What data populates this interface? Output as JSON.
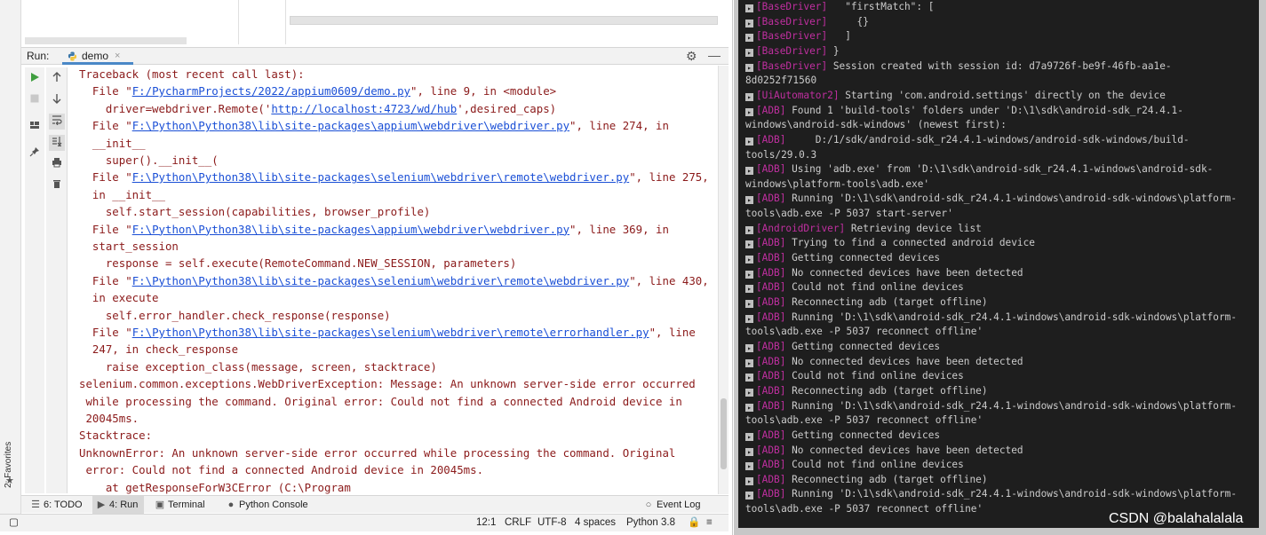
{
  "ide": {
    "run_label": "Run:",
    "run_tab": "demo",
    "run_tab_close": "×",
    "favorites_label": "2: Favorites",
    "console_lines": [
      {
        "segs": [
          {
            "t": "Traceback (most recent call last):"
          }
        ]
      },
      {
        "segs": [
          {
            "t": "  File \""
          },
          {
            "t": "F:/PycharmProjects/2022/appium0609/demo.py",
            "link": true
          },
          {
            "t": "\", line 9, in <module>"
          }
        ]
      },
      {
        "segs": [
          {
            "t": "    driver=webdriver.Remote('"
          },
          {
            "t": "http://localhost:4723/wd/hub",
            "link": true
          },
          {
            "t": "',desired_caps)"
          }
        ]
      },
      {
        "segs": [
          {
            "t": "  File \""
          },
          {
            "t": "F:\\Python\\Python38\\lib\\site-packages\\appium\\webdriver\\webdriver.py",
            "link": true
          },
          {
            "t": "\", line 274, in"
          }
        ]
      },
      {
        "segs": [
          {
            "t": "  __init__"
          }
        ]
      },
      {
        "segs": [
          {
            "t": "    super().__init__("
          }
        ]
      },
      {
        "segs": [
          {
            "t": "  File \""
          },
          {
            "t": "F:\\Python\\Python38\\lib\\site-packages\\selenium\\webdriver\\remote\\webdriver.py",
            "link": true
          },
          {
            "t": "\", line 275,"
          }
        ]
      },
      {
        "segs": [
          {
            "t": "  in __init__"
          }
        ]
      },
      {
        "segs": [
          {
            "t": "    self.start_session(capabilities, browser_profile)"
          }
        ]
      },
      {
        "segs": [
          {
            "t": "  File \""
          },
          {
            "t": "F:\\Python\\Python38\\lib\\site-packages\\appium\\webdriver\\webdriver.py",
            "link": true
          },
          {
            "t": "\", line 369, in"
          }
        ]
      },
      {
        "segs": [
          {
            "t": "  start_session"
          }
        ]
      },
      {
        "segs": [
          {
            "t": "    response = self.execute(RemoteCommand.NEW_SESSION, parameters)"
          }
        ]
      },
      {
        "segs": [
          {
            "t": "  File \""
          },
          {
            "t": "F:\\Python\\Python38\\lib\\site-packages\\selenium\\webdriver\\remote\\webdriver.py",
            "link": true
          },
          {
            "t": "\", line 430,"
          }
        ]
      },
      {
        "segs": [
          {
            "t": "  in execute"
          }
        ]
      },
      {
        "segs": [
          {
            "t": "    self.error_handler.check_response(response)"
          }
        ]
      },
      {
        "segs": [
          {
            "t": "  File \""
          },
          {
            "t": "F:\\Python\\Python38\\lib\\site-packages\\selenium\\webdriver\\remote\\errorhandler.py",
            "link": true
          },
          {
            "t": "\", line"
          }
        ]
      },
      {
        "segs": [
          {
            "t": "  247, in check_response"
          }
        ]
      },
      {
        "segs": [
          {
            "t": "    raise exception_class(message, screen, stacktrace)"
          }
        ]
      },
      {
        "segs": [
          {
            "t": "selenium.common.exceptions.WebDriverException: Message: An unknown server-side error occurred"
          }
        ]
      },
      {
        "segs": [
          {
            "t": " while processing the command. Original error: Could not find a connected Android device in"
          }
        ]
      },
      {
        "segs": [
          {
            "t": " 20045ms."
          }
        ]
      },
      {
        "segs": [
          {
            "t": "Stacktrace:"
          }
        ]
      },
      {
        "segs": [
          {
            "t": "UnknownError: An unknown server-side error occurred while processing the command. Original"
          }
        ]
      },
      {
        "segs": [
          {
            "t": " error: Could not find a connected Android device in 20045ms."
          }
        ]
      },
      {
        "segs": [
          {
            "t": "    at getResponseForW3CError (C:\\Program"
          }
        ]
      }
    ],
    "bottom_tabs": [
      {
        "label": "6: TODO",
        "icon": "list-icon",
        "active": false
      },
      {
        "label": "4: Run",
        "icon": "run-icon",
        "active": true
      },
      {
        "label": "Terminal",
        "icon": "terminal-icon",
        "active": false
      },
      {
        "label": "Python Console",
        "icon": "python-icon",
        "active": false
      }
    ],
    "event_log": "Event Log",
    "status": {
      "position": "12:1",
      "line_sep": "CRLF",
      "encoding": "UTF-8",
      "indent": "4 spaces",
      "interpreter": "Python 3.8"
    },
    "colors": {
      "error_text": "#8b1a1a",
      "link": "#1a4fd6",
      "run_green": "#3f9e3f"
    }
  },
  "terminal": {
    "lines": [
      {
        "tag": "[BaseDriver]",
        "text": "  \"firstMatch\": ["
      },
      {
        "tag": "[BaseDriver]",
        "text": "    {}"
      },
      {
        "tag": "[BaseDriver]",
        "text": "  ]"
      },
      {
        "tag": "[BaseDriver]",
        "text": "}"
      },
      {
        "tag": "[BaseDriver]",
        "text": "Session created with session id: d7a9726f-be9f-46fb-aa1e-"
      },
      {
        "tag": "",
        "text": "8d0252f71560",
        "cont": true
      },
      {
        "tag": "[UiAutomator2]",
        "text": "Starting 'com.android.settings' directly on the device"
      },
      {
        "tag": "[ADB]",
        "text": "Found 1 'build-tools' folders under 'D:\\1\\sdk\\android-sdk_r24.4.1-"
      },
      {
        "tag": "",
        "text": "windows\\android-sdk-windows' (newest first):",
        "cont": true
      },
      {
        "tag": "[ADB]",
        "text": "    D:/1/sdk/android-sdk_r24.4.1-windows/android-sdk-windows/build-"
      },
      {
        "tag": "",
        "text": "tools/29.0.3",
        "cont": true
      },
      {
        "tag": "[ADB]",
        "text": "Using 'adb.exe' from 'D:\\1\\sdk\\android-sdk_r24.4.1-windows\\android-sdk-"
      },
      {
        "tag": "",
        "text": "windows\\platform-tools\\adb.exe'",
        "cont": true
      },
      {
        "tag": "[ADB]",
        "text": "Running 'D:\\1\\sdk\\android-sdk_r24.4.1-windows\\android-sdk-windows\\platform-"
      },
      {
        "tag": "",
        "text": "tools\\adb.exe -P 5037 start-server'",
        "cont": true
      },
      {
        "tag": "[AndroidDriver]",
        "text": "Retrieving device list"
      },
      {
        "tag": "[ADB]",
        "text": "Trying to find a connected android device"
      },
      {
        "tag": "[ADB]",
        "text": "Getting connected devices"
      },
      {
        "tag": "[ADB]",
        "text": "No connected devices have been detected"
      },
      {
        "tag": "[ADB]",
        "text": "Could not find online devices"
      },
      {
        "tag": "[ADB]",
        "text": "Reconnecting adb (target offline)"
      },
      {
        "tag": "[ADB]",
        "text": "Running 'D:\\1\\sdk\\android-sdk_r24.4.1-windows\\android-sdk-windows\\platform-"
      },
      {
        "tag": "",
        "text": "tools\\adb.exe -P 5037 reconnect offline'",
        "cont": true
      },
      {
        "tag": "[ADB]",
        "text": "Getting connected devices"
      },
      {
        "tag": "[ADB]",
        "text": "No connected devices have been detected"
      },
      {
        "tag": "[ADB]",
        "text": "Could not find online devices"
      },
      {
        "tag": "[ADB]",
        "text": "Reconnecting adb (target offline)"
      },
      {
        "tag": "[ADB]",
        "text": "Running 'D:\\1\\sdk\\android-sdk_r24.4.1-windows\\android-sdk-windows\\platform-"
      },
      {
        "tag": "",
        "text": "tools\\adb.exe -P 5037 reconnect offline'",
        "cont": true
      },
      {
        "tag": "[ADB]",
        "text": "Getting connected devices"
      },
      {
        "tag": "[ADB]",
        "text": "No connected devices have been detected"
      },
      {
        "tag": "[ADB]",
        "text": "Could not find online devices"
      },
      {
        "tag": "[ADB]",
        "text": "Reconnecting adb (target offline)"
      },
      {
        "tag": "[ADB]",
        "text": "Running 'D:\\1\\sdk\\android-sdk_r24.4.1-windows\\android-sdk-windows\\platform-"
      },
      {
        "tag": "",
        "text": "tools\\adb.exe -P 5037 reconnect offline'",
        "cont": true
      }
    ],
    "colors": {
      "background": "#1e1e1e",
      "text": "#cccccc",
      "tag": "#c02fa0"
    }
  },
  "watermark": "CSDN @balahalalala"
}
